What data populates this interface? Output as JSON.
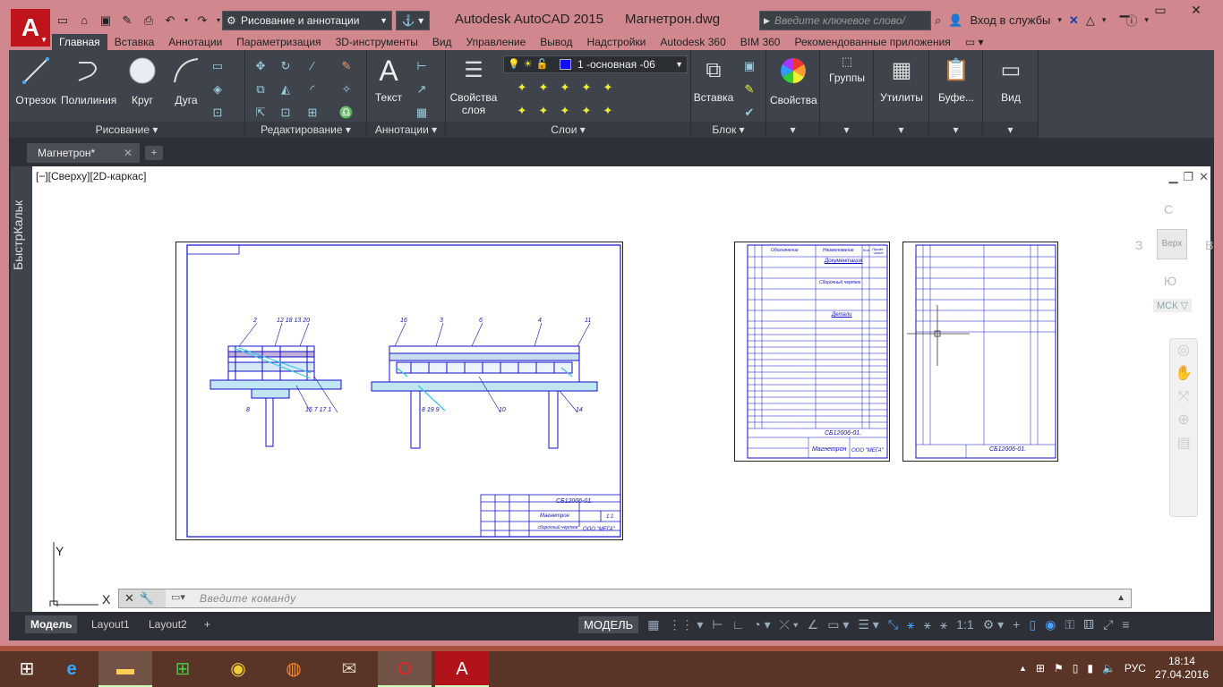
{
  "window": {
    "title_app": "Autodesk AutoCAD 2015",
    "title_file": "Магнетрон.dwg",
    "workspace": "Рисование и аннотации",
    "search_placeholder": "Введите ключевое слово/фразу",
    "signin": "Вход в службы"
  },
  "ribbon": {
    "tabs": [
      "Главная",
      "Вставка",
      "Аннотации",
      "Параметризация",
      "3D-инструменты",
      "Вид",
      "Управление",
      "Вывод",
      "Надстройки",
      "Autodesk 360",
      "BIM 360",
      "Рекомендованные приложения"
    ],
    "draw": {
      "title": "Рисование",
      "line": "Отрезок",
      "polyline": "Полилиния",
      "circle": "Круг",
      "arc": "Дуга"
    },
    "modify": {
      "title": "Редактирование"
    },
    "annotation": {
      "title": "Аннотации",
      "text": "Текст"
    },
    "layers": {
      "title": "Слои",
      "layer_properties_1": "Свойства",
      "layer_properties_2": "слоя",
      "current_layer": "1 -основная -06"
    },
    "block": {
      "title": "Блок",
      "insert": "Вставка"
    },
    "properties": "Свойства",
    "groups": "Группы",
    "utilities": "Утилиты",
    "clipboard": "Буфе...",
    "view": "Вид"
  },
  "document": {
    "tab": "Магнетрон*"
  },
  "palette": {
    "label": "БыстрКальк"
  },
  "viewport": {
    "label": "[−][Сверху][2D-каркас]",
    "viewcube": {
      "north": "С",
      "west": "З",
      "east": "В",
      "south": "Ю",
      "top": "Верх",
      "ucs": "МСК"
    }
  },
  "drawing": {
    "sheet1_code": "СБ12006-01.",
    "sheet1_name": "Магнетрон",
    "sheet1_type": "сборочный чертеж",
    "sheet1_org": "ООО \"МЕГА\"",
    "sheet1_scale": "1:1",
    "sheet2_code": "СБ12006-01.",
    "sheet2_name": "Магнетрон",
    "sheet2_org": "ООО \"МЕГА\"",
    "sheet3_code": "СБ12006-01.",
    "sheet2_header": [
      "Обозначение",
      "Наименование",
      "Кол.",
      "Приме-чание"
    ],
    "sheet2_sections": [
      "Документация",
      "Сборочный чертеж",
      "Детали"
    ]
  },
  "ucs": {
    "x": "X",
    "y": "Y"
  },
  "command": {
    "placeholder": "Введите команду"
  },
  "layouts": [
    "Модель",
    "Layout1",
    "Layout2"
  ],
  "status": {
    "model": "МОДЕЛЬ",
    "scale": "1:1"
  },
  "taskbar": {
    "time": "18:14",
    "date": "27.04.2016",
    "lang": "РУС"
  },
  "colors": {
    "title_bar": "#d0888e",
    "ribbon": "#3f444c",
    "drawing_blue": "#1010c8",
    "drawing_cyan": "#30c8e8"
  }
}
